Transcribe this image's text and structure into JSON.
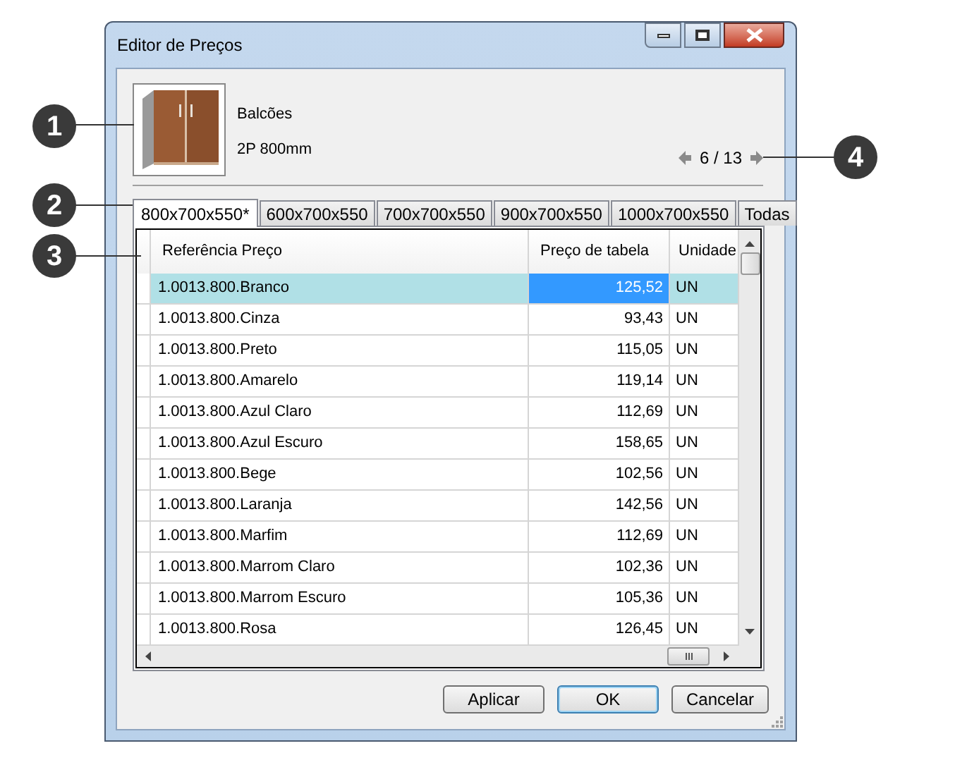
{
  "window": {
    "title": "Editor de Preços"
  },
  "product": {
    "category": "Balcões",
    "name": "2P 800mm"
  },
  "navigation": {
    "position": "6 / 13"
  },
  "tabs": [
    {
      "label": "800x700x550*",
      "selected": true
    },
    {
      "label": "600x700x550",
      "selected": false
    },
    {
      "label": "700x700x550",
      "selected": false
    },
    {
      "label": "900x700x550",
      "selected": false
    },
    {
      "label": "1000x700x550",
      "selected": false
    },
    {
      "label": "Todas",
      "selected": false
    }
  ],
  "table": {
    "columns": [
      "Referência Preço",
      "Preço de tabela",
      "Unidade"
    ],
    "rows": [
      {
        "reference": "1.0013.800.Branco",
        "price": "125,52",
        "unit": "UN",
        "selected": true
      },
      {
        "reference": "1.0013.800.Cinza",
        "price": "93,43",
        "unit": "UN",
        "selected": false
      },
      {
        "reference": "1.0013.800.Preto",
        "price": "115,05",
        "unit": "UN",
        "selected": false
      },
      {
        "reference": "1.0013.800.Amarelo",
        "price": "119,14",
        "unit": "UN",
        "selected": false
      },
      {
        "reference": "1.0013.800.Azul Claro",
        "price": "112,69",
        "unit": "UN",
        "selected": false
      },
      {
        "reference": "1.0013.800.Azul Escuro",
        "price": "158,65",
        "unit": "UN",
        "selected": false
      },
      {
        "reference": "1.0013.800.Bege",
        "price": "102,56",
        "unit": "UN",
        "selected": false
      },
      {
        "reference": "1.0013.800.Laranja",
        "price": "142,56",
        "unit": "UN",
        "selected": false
      },
      {
        "reference": "1.0013.800.Marfim",
        "price": "112,69",
        "unit": "UN",
        "selected": false
      },
      {
        "reference": "1.0013.800.Marrom Claro",
        "price": "102,36",
        "unit": "UN",
        "selected": false
      },
      {
        "reference": "1.0013.800.Marrom Escuro",
        "price": "105,36",
        "unit": "UN",
        "selected": false
      },
      {
        "reference": "1.0013.800.Rosa",
        "price": "126,45",
        "unit": "UN",
        "selected": false
      }
    ]
  },
  "buttons": [
    {
      "label": "Aplicar",
      "default": false
    },
    {
      "label": "OK",
      "default": true
    },
    {
      "label": "Cancelar",
      "default": false
    }
  ],
  "callouts": [
    {
      "number": "1"
    },
    {
      "number": "2"
    },
    {
      "number": "3"
    },
    {
      "number": "4"
    }
  ]
}
